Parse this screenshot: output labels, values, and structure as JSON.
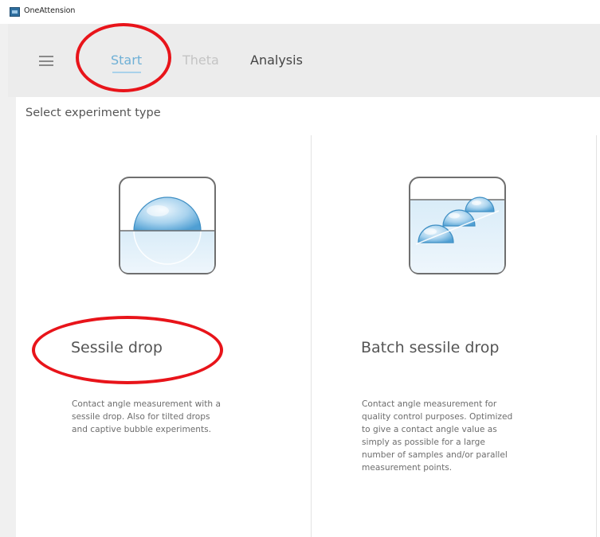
{
  "window": {
    "title": "OneAttension"
  },
  "toolbar": {
    "menu_icon": "hamburger-menu-icon",
    "tabs": [
      {
        "label": "Start",
        "state": "active"
      },
      {
        "label": "Theta",
        "state": "disabled"
      },
      {
        "label": "Analysis",
        "state": "enabled"
      }
    ]
  },
  "main": {
    "heading": "Select experiment type",
    "cards": [
      {
        "icon": "sessile-drop-icon",
        "title": "Sessile drop",
        "description_lines": [
          "Contact angle measurement with a",
          "sessile drop. Also for tilted drops",
          "and captive bubble experiments."
        ]
      },
      {
        "icon": "batch-sessile-drop-icon",
        "title": "Batch sessile drop",
        "description_lines": [
          "Contact angle measurement for",
          "quality control purposes. Optimized",
          "to give a contact angle value as",
          "simply as possible for a large",
          "number of samples and/or parallel",
          "measurement points."
        ]
      }
    ]
  },
  "colors": {
    "active_tab": "#6fb0d6",
    "disabled_tab": "#c4c4c4",
    "annotation": "#e8141a",
    "drop_blue": "#5ea9d8"
  }
}
